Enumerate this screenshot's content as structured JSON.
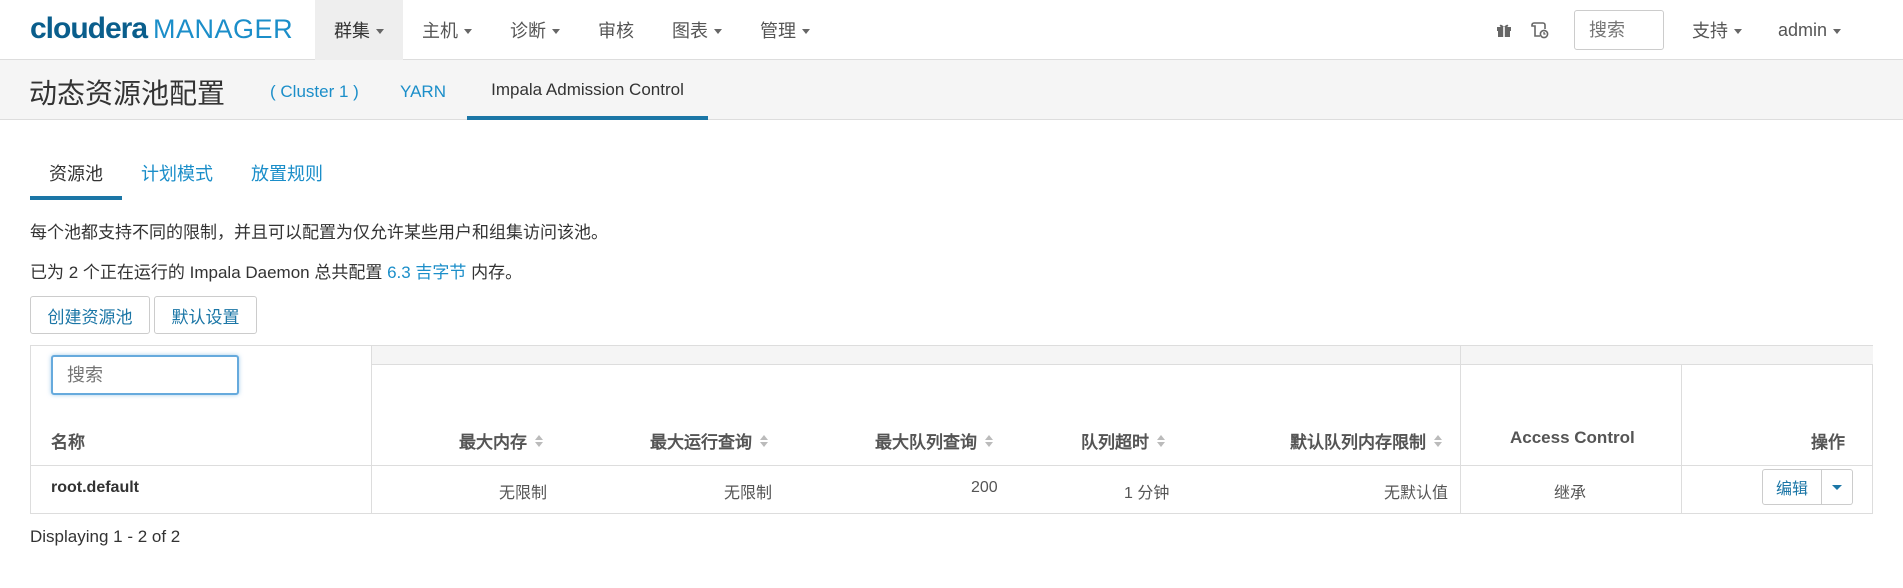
{
  "brand": {
    "name": "cloudera",
    "product": "MANAGER"
  },
  "nav": {
    "items": [
      {
        "label": "群集",
        "dropdown": true,
        "active": true
      },
      {
        "label": "主机",
        "dropdown": true
      },
      {
        "label": "诊断",
        "dropdown": true
      },
      {
        "label": "审核",
        "dropdown": false
      },
      {
        "label": "图表",
        "dropdown": true
      },
      {
        "label": "管理",
        "dropdown": true
      }
    ],
    "search_placeholder": "搜索",
    "support_label": "支持",
    "user_label": "admin",
    "icons": [
      "gift-icon",
      "running-commands-icon"
    ]
  },
  "subheader": {
    "title": "动态资源池配置",
    "cluster": "( Cluster 1 )",
    "tabs": [
      {
        "label": "YARN",
        "active": false
      },
      {
        "label": "Impala Admission Control",
        "active": true
      }
    ]
  },
  "subtabs": [
    {
      "label": "资源池",
      "active": true
    },
    {
      "label": "计划模式",
      "active": false
    },
    {
      "label": "放置规则",
      "active": false
    }
  ],
  "description": {
    "line1": "每个池都支持不同的限制，并且可以配置为仅允许某些用户和组集访问该池。",
    "line2_pre": "已为 2 个正在运行的 Impala Daemon 总共配置 ",
    "line2_link": "6.3 吉字节",
    "line2_post": " 内存。"
  },
  "buttons": {
    "create": "创建资源池",
    "defaults": "默认设置"
  },
  "table": {
    "search_placeholder": "搜索",
    "headers": {
      "name": "名称",
      "max_memory": "最大内存",
      "max_running": "最大运行查询",
      "max_queued": "最大队列查询",
      "queue_timeout": "队列超时",
      "default_queue_mem": "默认队列内存限制",
      "access_control": "Access Control",
      "actions": "操作"
    },
    "rows": [
      {
        "name": "root.default",
        "max_memory": "无限制",
        "max_running": "无限制",
        "max_queued": "200",
        "queue_timeout": "1 分钟",
        "default_queue_mem": "无默认值",
        "access_control": "继承",
        "action": "编辑"
      }
    ]
  },
  "footer": "Displaying 1 - 2 of 2",
  "colors": {
    "accent": "#1b8ec9",
    "tab_underline": "#1b76a6"
  }
}
